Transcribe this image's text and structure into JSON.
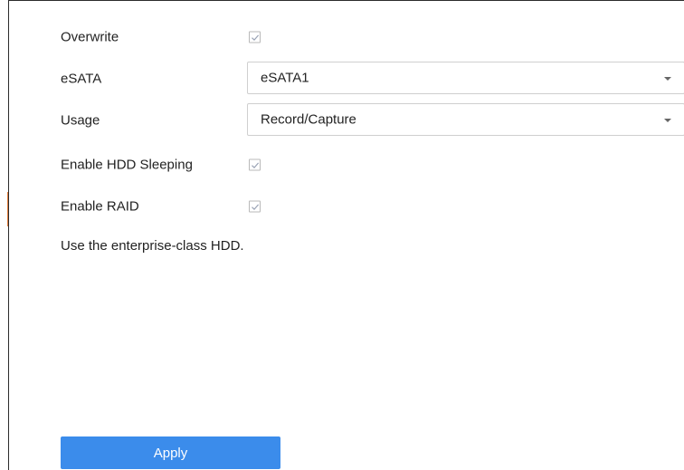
{
  "form": {
    "overwrite": {
      "label": "Overwrite",
      "checked": true
    },
    "esata": {
      "label": "eSATA",
      "value": "eSATA1"
    },
    "usage": {
      "label": "Usage",
      "value": "Record/Capture"
    },
    "hdd_sleeping": {
      "label": "Enable HDD Sleeping",
      "checked": true
    },
    "raid": {
      "label": "Enable RAID",
      "checked": true
    },
    "note": "Use the enterprise-class HDD."
  },
  "actions": {
    "apply_label": "Apply"
  },
  "colors": {
    "primary_button": "#3b8ceb",
    "checkmark": "#9aa3b5",
    "accent_edge": "#e07b39"
  },
  "icons": {
    "checkbox_mark": "check-icon",
    "dropdown_caret": "chevron-down-icon"
  }
}
